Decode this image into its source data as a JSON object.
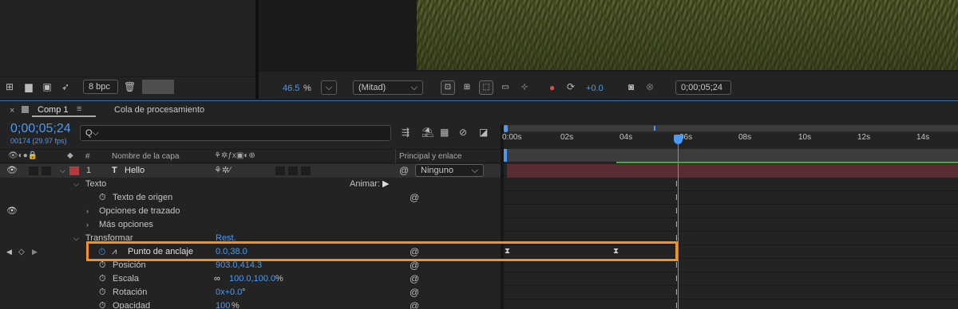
{
  "left_toolbar": {
    "bpc_label": "8 bpc",
    "icons": [
      "flowchart-icon",
      "folder-icon",
      "film-settings-icon",
      "render-icon",
      "trash-icon"
    ]
  },
  "viewer_toolbar": {
    "zoom_value": "46.5",
    "zoom_unit": "%",
    "resolution": "(Mitad)",
    "exposure": "+0.0",
    "timecode": "0;00;05;24"
  },
  "comp_panel": {
    "tab_comp": "Comp 1",
    "tab_queue": "Cola de procesamiento",
    "timecode": "0;00;05;24",
    "frame_info": "00174 (29.97 fps)",
    "search_placeholder": "Q⌵"
  },
  "columns": {
    "hash": "#",
    "layer_name": "Nombre de la capa",
    "parent": "Principal y enlace"
  },
  "layer": {
    "number": "1",
    "type_glyph": "T",
    "name": "Hello",
    "parent_value": "Ninguno"
  },
  "properties": {
    "texto": "Texto",
    "animar": "Animar:",
    "texto_origen": "Texto de origen",
    "opciones_trazado": "Opciones de trazado",
    "mas_opciones": "Más opciones",
    "transformar": "Transformar",
    "restablecer": "Rest.",
    "anchor_label": "Punto de anclaje",
    "anchor_value": "0.0,38.0",
    "position_label": "Posición",
    "position_value": "903.0,414.3",
    "scale_label": "Escala",
    "scale_value": "100.0,100.0",
    "scale_unit": "%",
    "rotation_label": "Rotación",
    "rotation_value": "0x+0.0",
    "rotation_unit": "°",
    "opacity_label": "Opacidad",
    "opacity_value": "100",
    "opacity_unit": "%"
  },
  "timeline": {
    "ruler_labels": [
      "0:00s",
      "02s",
      "04s",
      "06s",
      "08s",
      "10s",
      "12s",
      "14s"
    ],
    "playhead_label": "06s"
  },
  "colors": {
    "accent_blue": "#4a9af5",
    "highlight_orange": "#f0922b",
    "layer_bar": "#5b2c31",
    "work_area_green": "#34b43c",
    "label_red": "#b5393f"
  }
}
